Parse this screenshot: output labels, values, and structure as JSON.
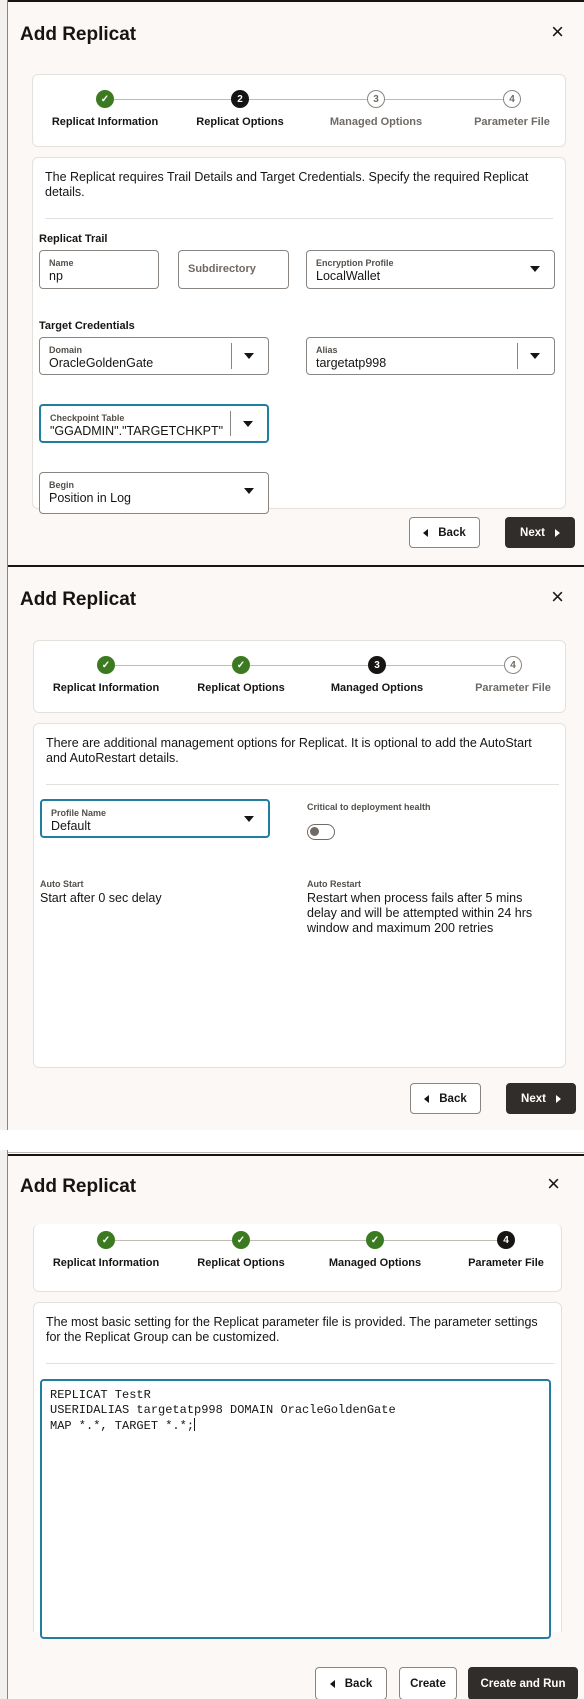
{
  "dialog": {
    "title": "Add Replicat",
    "close_label": "×"
  },
  "steps": [
    {
      "label": "Replicat Information",
      "number": "1"
    },
    {
      "label": "Replicat Options",
      "number": "2"
    },
    {
      "label": "Managed Options",
      "number": "3"
    },
    {
      "label": "Parameter File",
      "number": "4"
    }
  ],
  "colors": {
    "done": "#3c7a22",
    "current": "#161513",
    "focus": "#227e9e",
    "primary_button": "#312d2a"
  },
  "screen1": {
    "intro": "The Replicat requires Trail Details and Target Credentials. Specify the required Replicat details.",
    "replicat_trail": {
      "heading": "Replicat Trail",
      "name": {
        "label": "Name",
        "value": "np"
      },
      "subdirectory": {
        "placeholder": "Subdirectory"
      },
      "encryption_profile": {
        "label": "Encryption Profile",
        "value": "LocalWallet"
      }
    },
    "target_credentials": {
      "heading": "Target Credentials",
      "domain": {
        "label": "Domain",
        "value": "OracleGoldenGate"
      },
      "alias": {
        "label": "Alias",
        "value": "targetatp998"
      }
    },
    "checkpoint_table": {
      "label": "Checkpoint Table",
      "value": "\"GGADMIN\".\"TARGETCHKPT\""
    },
    "begin": {
      "label": "Begin",
      "value": "Position in Log"
    },
    "back_label": "Back",
    "next_label": "Next"
  },
  "screen2": {
    "intro": "There are additional management options for Replicat. It is optional to add the AutoStart and AutoRestart details.",
    "profile_name": {
      "label": "Profile Name",
      "value": "Default"
    },
    "critical_label": "Critical to deployment health",
    "critical_enabled": false,
    "auto_start": {
      "label": "Auto Start",
      "value": "Start after 0 sec delay"
    },
    "auto_restart": {
      "label": "Auto Restart",
      "value": "Restart when process fails after 5 mins delay and will be attempted within 24 hrs window and maximum 200 retries"
    },
    "back_label": "Back",
    "next_label": "Next"
  },
  "screen3": {
    "intro": "The most basic setting for the Replicat parameter file is provided. The parameter settings for the Replicat Group can be customized.",
    "param_lines": [
      "REPLICAT TestR",
      "USERIDALIAS targetatp998 DOMAIN OracleGoldenGate",
      "MAP *.*, TARGET *.*;"
    ],
    "back_label": "Back",
    "create_label": "Create",
    "create_run_label": "Create and Run"
  }
}
